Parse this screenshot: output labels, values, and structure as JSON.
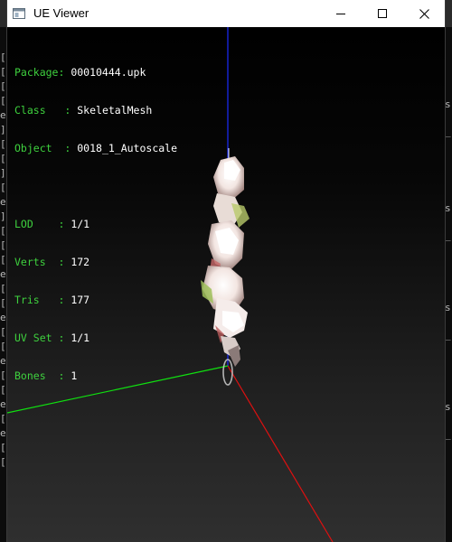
{
  "window": {
    "title": "UE Viewer"
  },
  "info": {
    "package": {
      "label": "Package: ",
      "value": "00010444.upk"
    },
    "class": {
      "label": "Class   : ",
      "value": "SkeletalMesh"
    },
    "object": {
      "label": "Object  : ",
      "value": "0018_1_Autoscale"
    },
    "lod": {
      "label": "LOD    : ",
      "value": "1/1"
    },
    "verts": {
      "label": "Verts  : ",
      "value": "172"
    },
    "tris": {
      "label": "Tris   : ",
      "value": "177"
    },
    "uvset": {
      "label": "UV Set : ",
      "value": "1/1"
    },
    "bones": {
      "label": "Bones  : ",
      "value": "1"
    }
  },
  "background_console": {
    "left_chars": [
      "[",
      "[",
      "[",
      "[",
      "e",
      "]",
      "[",
      "[",
      "]",
      "[",
      "e",
      "]",
      "[",
      "[",
      "[",
      "e",
      "[",
      "[",
      "e",
      "[",
      "[",
      "e",
      "[",
      "[",
      "e",
      "[",
      "e",
      "[",
      "["
    ],
    "right_chars": [
      "s",
      "_",
      "s",
      "_",
      "s",
      "_",
      "s",
      "_"
    ]
  },
  "colors": {
    "axis_x": "#e01010",
    "axis_y": "#10e010",
    "axis_z": "#1a2cff",
    "label_green": "#3ed13e"
  },
  "icons": {
    "app": "window-app-icon",
    "minimize": "minimize-icon",
    "maximize": "maximize-icon",
    "close": "close-icon"
  }
}
